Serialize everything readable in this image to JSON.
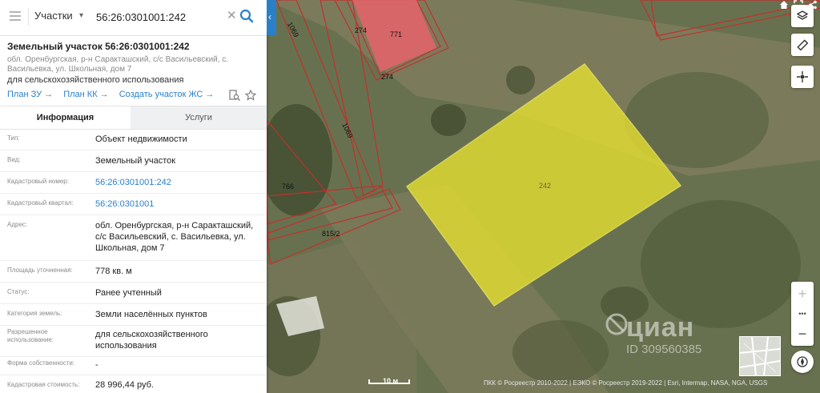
{
  "search": {
    "layer": "Участки",
    "query": "56:26:0301001:242"
  },
  "object": {
    "title": "Земельный участок 56:26:0301001:242",
    "address": "обл. Оренбургская, р-н Саракташский, с/с Васильевский, с. Васильевка, ул. Школьная, дом 7",
    "use": "для сельскохозяйственного использования",
    "links": [
      "План ЗУ",
      "План КК",
      "Создать участок ЖС"
    ]
  },
  "tabs": [
    "Информация",
    "Услуги"
  ],
  "properties": [
    {
      "label": "Тип:",
      "value": "Объект недвижимости"
    },
    {
      "label": "Вид:",
      "value": "Земельный участок"
    },
    {
      "label": "Кадастровый номер:",
      "value": "56:26:0301001:242"
    },
    {
      "label": "Кадастровый квартал:",
      "value": "56:26:0301001"
    },
    {
      "label": "Адрес:",
      "value": "обл. Оренбургская, р-н Саракташский, с/с Васильевский, с. Васильевка, ул. Школьная, дом 7"
    },
    {
      "label": "Площадь уточненная:",
      "value": "778 кв. м"
    },
    {
      "label": "Статус:",
      "value": "Ранее учтенный"
    },
    {
      "label": "Категория земель:",
      "value": "Земли населённых пунктов"
    },
    {
      "label": "Разрешенное использование:",
      "value": "для сельскохозяйственного использования"
    },
    {
      "label": "Форма собственности:",
      "value": "-"
    },
    {
      "label": "Кадастровая стоимость:",
      "value": "28 996,44 руб."
    }
  ],
  "map": {
    "parcel_labels": [
      "1069",
      "274",
      "771",
      "274",
      "1069",
      "766",
      "815/2",
      "242"
    ],
    "scale": "10 м",
    "attribution": "ПКК © Росреестр 2010-2022 | ЕЭКО © Росреестр 2019-2022 | Esri, Intermap, NASA, NGA, USGS",
    "watermark": "циан",
    "watermark_id": "ID 309560385",
    "highlight_color": "#e8e230",
    "boundary_color": "#c0312c"
  },
  "controls": {
    "zoom_in": "+",
    "more": "•••",
    "zoom_out": "−"
  }
}
